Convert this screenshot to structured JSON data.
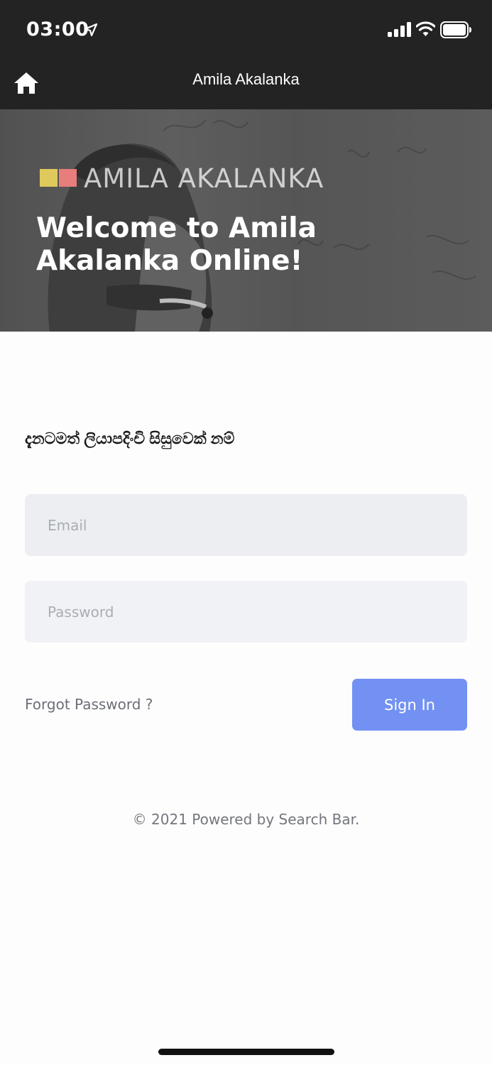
{
  "status_bar": {
    "time": "03:00"
  },
  "nav": {
    "title": "Amila Akalanka"
  },
  "hero": {
    "brand_text": "AMILA AKALANKA",
    "heading": "Welcome to Amila Akalanka Online!",
    "logo_colors": [
      "#e0c95c",
      "#e77e7c"
    ]
  },
  "login": {
    "subtitle": "දැනටමත් ලියාපදිංචි සිසුවෙක් නම්",
    "email_placeholder": "Email",
    "password_placeholder": "Password",
    "forgot_label": "Forgot Password ?",
    "signin_label": "Sign In"
  },
  "footer": {
    "text": "© 2021 Powered by Search Bar."
  },
  "colors": {
    "accent": "#7291f3",
    "bar_background": "#232323"
  }
}
